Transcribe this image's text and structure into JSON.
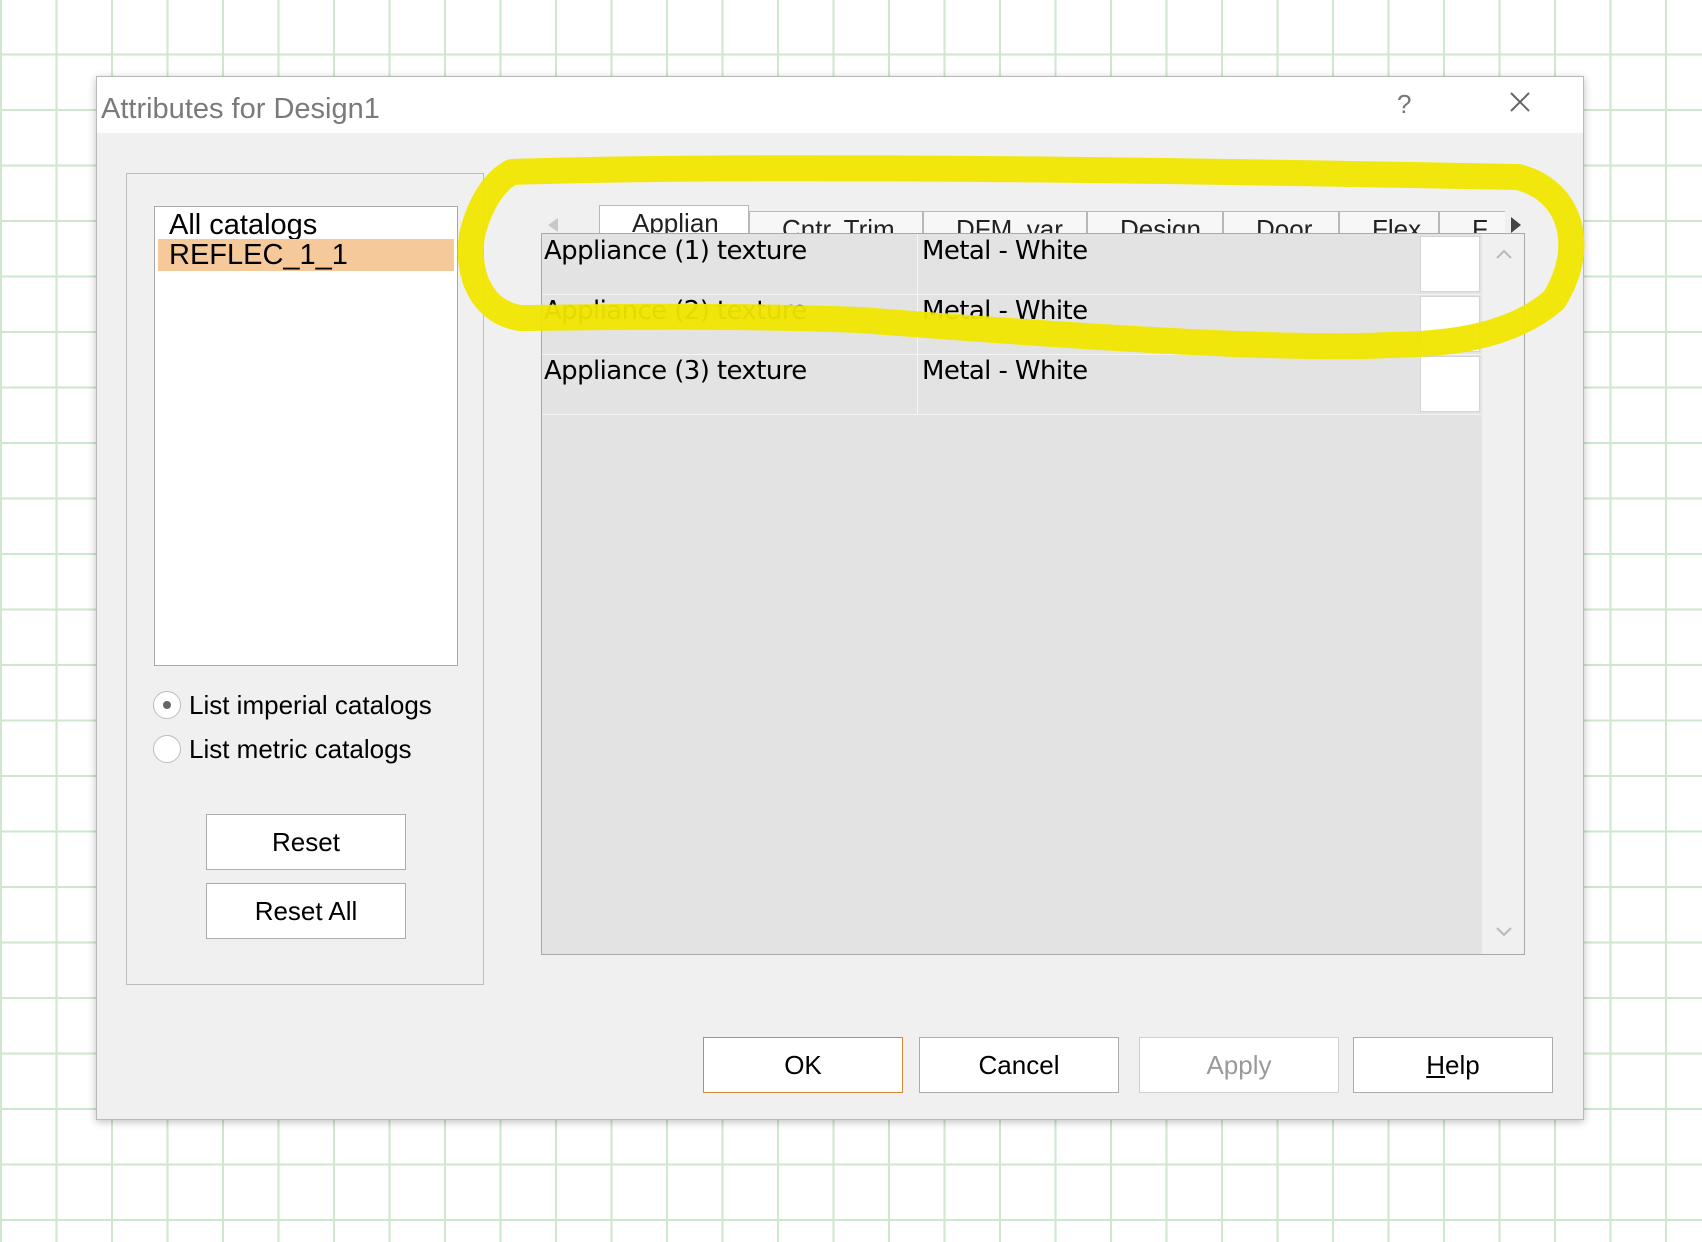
{
  "dialog": {
    "title": "Attributes for Design1",
    "help_glyph": "?"
  },
  "catalogs": {
    "items": [
      {
        "label": "All catalogs",
        "selected": false
      },
      {
        "label": "REFLEC_1_1",
        "selected": true
      }
    ]
  },
  "units": {
    "imperial_label": "List imperial catalogs",
    "imperial_checked": true,
    "metric_label": "List metric catalogs",
    "metric_checked": false
  },
  "left_buttons": {
    "reset": "Reset",
    "reset_all": "Reset All"
  },
  "tabs": [
    {
      "label": "Applian",
      "active": true
    },
    {
      "label": "Cntr. Trim",
      "active": false
    },
    {
      "label": "DFM_var",
      "active": false
    },
    {
      "label": "Design",
      "active": false
    },
    {
      "label": "Door",
      "active": false
    },
    {
      "label": "Flex",
      "active": false
    },
    {
      "label": "F",
      "active": false
    }
  ],
  "attributes": [
    {
      "name": "Appliance (1) texture",
      "value": "Metal - White"
    },
    {
      "name": "Appliance (2) texture",
      "value": "Metal - White"
    },
    {
      "name": "Appliance (3) texture",
      "value": "Metal - White"
    }
  ],
  "footer": {
    "ok": "OK",
    "cancel": "Cancel",
    "apply": "Apply",
    "help_mnemonic": "H",
    "help_rest": "elp"
  },
  "colors": {
    "selection": "#f5c99a",
    "highlight_marker": "#f0e600",
    "ok_border": "#d08a3a"
  }
}
